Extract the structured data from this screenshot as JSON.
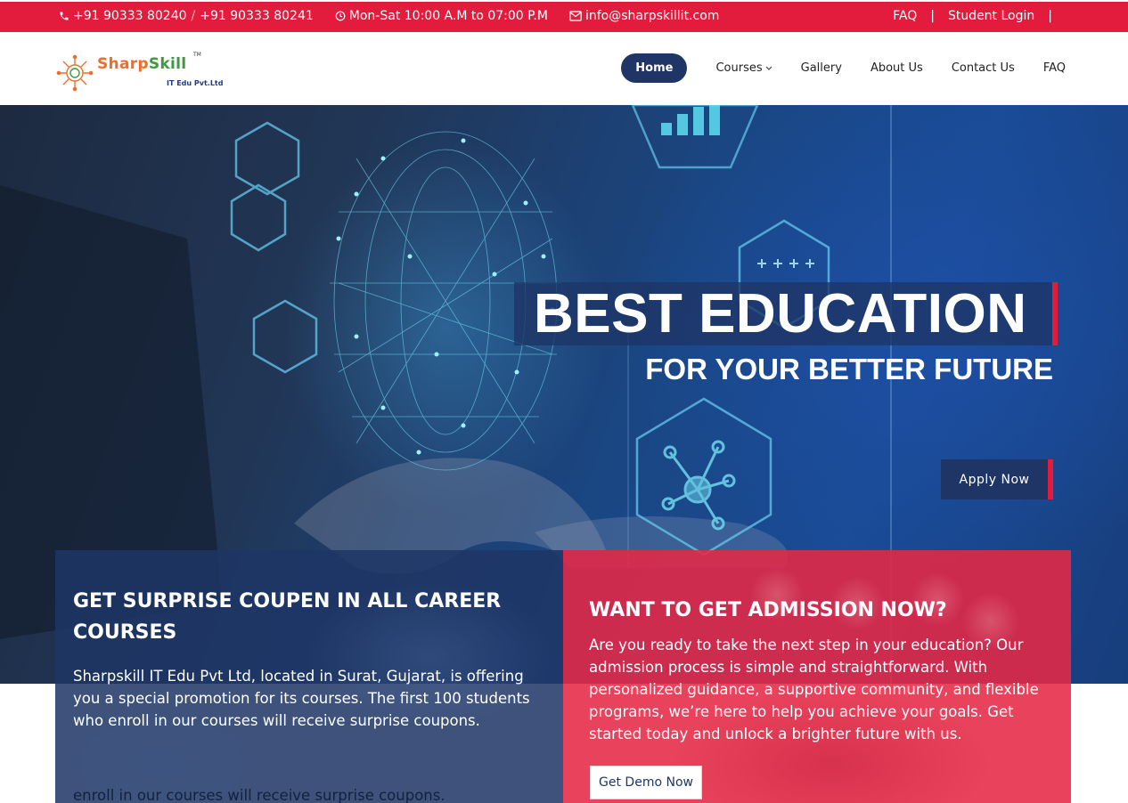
{
  "topbar": {
    "phone_1": "+91 90333 80240",
    "phone_sep": "/",
    "phone_2": "+91 90333 80241",
    "hours": "Mon-Sat 10:00 A.M to 07:00 P.M",
    "email": "info@sharpskillit.com",
    "links": {
      "faq": "FAQ",
      "student_login": "Student Login",
      "separator": "|"
    },
    "icons": {
      "phone": "phone-icon",
      "clock": "clock-icon",
      "email": "envelope-icon"
    },
    "colors": {
      "background": "#e31b3c"
    }
  },
  "header": {
    "logo": {
      "brand_part1": "Sharp",
      "brand_part2": "Skill",
      "trademark": "TM",
      "tagline": "IT Edu Pvt.Ltd"
    },
    "nav": {
      "home": "Home",
      "courses": "Courses",
      "gallery": "Gallery",
      "about": "About Us",
      "contact": "Contact Us",
      "faq": "FAQ"
    },
    "colors": {
      "active_nav": "#1e3565"
    }
  },
  "hero": {
    "title": "BEST EDUCATION",
    "subtitle": "FOR YOUR BETTER FUTURE",
    "cta": "Apply Now",
    "colors": {
      "accent": "#e31b3c",
      "panel": "#1e3565"
    }
  },
  "cards": {
    "left": {
      "title": "GET SURPRISE COUPEN IN ALL CAREER COURSES",
      "body": "Sharpskill IT Edu Pvt Ltd, located in Surat, Gujarat, is offering you a special promotion for its courses. The first 100 students who enroll in our courses will receive surprise coupons.",
      "overflow_text": "enroll in our courses will receive surprise coupons."
    },
    "right": {
      "title": "WANT TO GET ADMISSION NOW?",
      "body": "Are you ready to take the next step in your education? Our admission process is simple and straightforward. With personalized guidance, a supportive community, and flexible programs, we’re here to help you achieve your goals. Get started today and unlock a brighter future with us.",
      "cta": "Get Demo Now"
    }
  }
}
